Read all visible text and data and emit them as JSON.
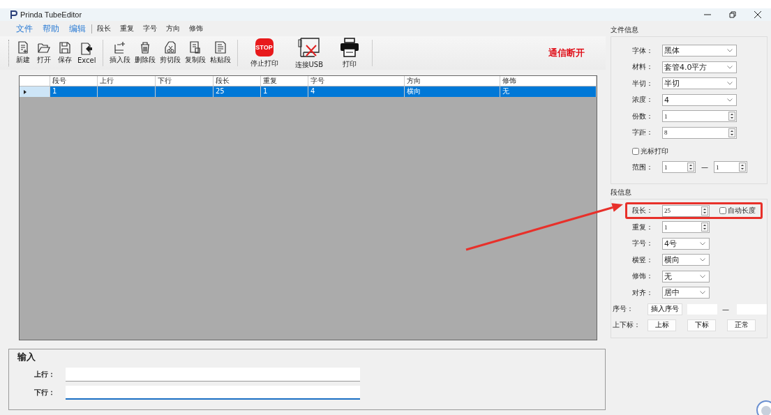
{
  "window": {
    "title": "Prinda TubeEditor"
  },
  "menu": [
    {
      "label": "文件",
      "kind": "main"
    },
    {
      "label": "帮助",
      "kind": "main"
    },
    {
      "label": "编辑",
      "kind": "main"
    },
    {
      "label": "段长",
      "kind": "sub"
    },
    {
      "label": "重复",
      "kind": "sub"
    },
    {
      "label": "字号",
      "kind": "sub"
    },
    {
      "label": "方向",
      "kind": "sub"
    },
    {
      "label": "修饰",
      "kind": "sub"
    }
  ],
  "toolbar": [
    {
      "label": "新建"
    },
    {
      "label": "打开"
    },
    {
      "label": "保存"
    },
    {
      "label": "Excel"
    },
    {
      "label": "插入段"
    },
    {
      "label": "删除段"
    },
    {
      "label": "剪切段"
    },
    {
      "label": "复制段"
    },
    {
      "label": "粘贴段"
    },
    {
      "label": "停止打印",
      "sign": "STOP"
    },
    {
      "label": "连接USB"
    },
    {
      "label": "打印"
    }
  ],
  "status": "通信断开",
  "grid": {
    "columns": [
      "段号",
      "上行",
      "下行",
      "段长",
      "重复",
      "字号",
      "方向",
      "修饰"
    ],
    "rows": [
      {
        "selected": true,
        "cells": [
          "1",
          "",
          "",
          "25",
          "1",
          "4",
          "横向",
          "无"
        ]
      }
    ]
  },
  "file_info": {
    "title": "文件信息",
    "fields": [
      {
        "label": "字体：",
        "kind": "combo",
        "value": "黑体"
      },
      {
        "label": "材料：",
        "kind": "combo",
        "value": "套管4.0平方"
      },
      {
        "label": "半切：",
        "kind": "combo",
        "value": "半切"
      },
      {
        "label": "浓度：",
        "kind": "combo",
        "value": "4"
      },
      {
        "label": "份数：",
        "kind": "spin",
        "value": "1"
      },
      {
        "label": "字距：",
        "kind": "spin",
        "value": "8"
      }
    ],
    "cursor_print": {
      "label": "光标打印",
      "checked": false
    },
    "range": {
      "label": "范围：",
      "from": "1",
      "separator": "—",
      "to": "1"
    }
  },
  "segment_info": {
    "title": "段信息",
    "length": {
      "label": "段长：",
      "value": "25"
    },
    "auto_length": {
      "label": "自动长度",
      "checked": false
    },
    "fields": [
      {
        "label": "重复：",
        "kind": "spin",
        "value": "1"
      },
      {
        "label": "字号：",
        "kind": "combo",
        "value": "4号"
      },
      {
        "label": "横竖：",
        "kind": "combo",
        "value": "横向"
      },
      {
        "label": "修饰：",
        "kind": "combo",
        "value": "无"
      },
      {
        "label": "对齐：",
        "kind": "combo",
        "value": "居中"
      }
    ],
    "serial": {
      "label": "序号：",
      "button": "插入序号",
      "separator": "—"
    },
    "subscript": {
      "label": "上下标：",
      "buttons": [
        "上标",
        "下标",
        "正常"
      ]
    }
  },
  "input": {
    "title": "输入",
    "fields": [
      {
        "label": "上行：",
        "focused": false
      },
      {
        "label": "下行：",
        "focused": true
      }
    ]
  }
}
